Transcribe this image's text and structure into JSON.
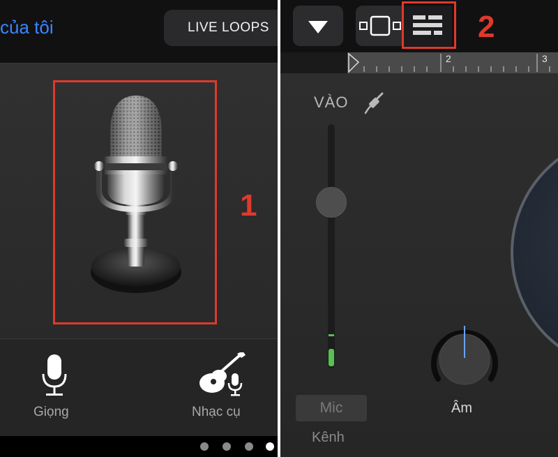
{
  "left_panel": {
    "back_link": "của tôi",
    "live_loops_button": "LIVE LOOPS",
    "callout_number": "1",
    "instruments": [
      {
        "label": "Giọng",
        "icon": "microphone-icon"
      },
      {
        "label": "Nhạc cụ",
        "icon": "guitar-mic-icon"
      }
    ],
    "page_dots": {
      "count": 4,
      "active_index": 3
    }
  },
  "right_panel": {
    "callout_number": "2",
    "toolbar": {
      "dropdown_icon": "triangle-down-icon",
      "tracks_view_icon": "tracks-view-icon",
      "mixer_icon": "mixer-controls-icon"
    },
    "ruler_labels": [
      "2",
      "3"
    ],
    "input_label": "VÀO",
    "input_icon": "audio-cable-icon",
    "input_level": 0.3,
    "channel_button": "Mic",
    "channel_label": "Kênh",
    "knob_label": "Âm"
  },
  "colors": {
    "highlight": "#e0392c",
    "link": "#3a86ff",
    "meter": "#56c24f"
  }
}
